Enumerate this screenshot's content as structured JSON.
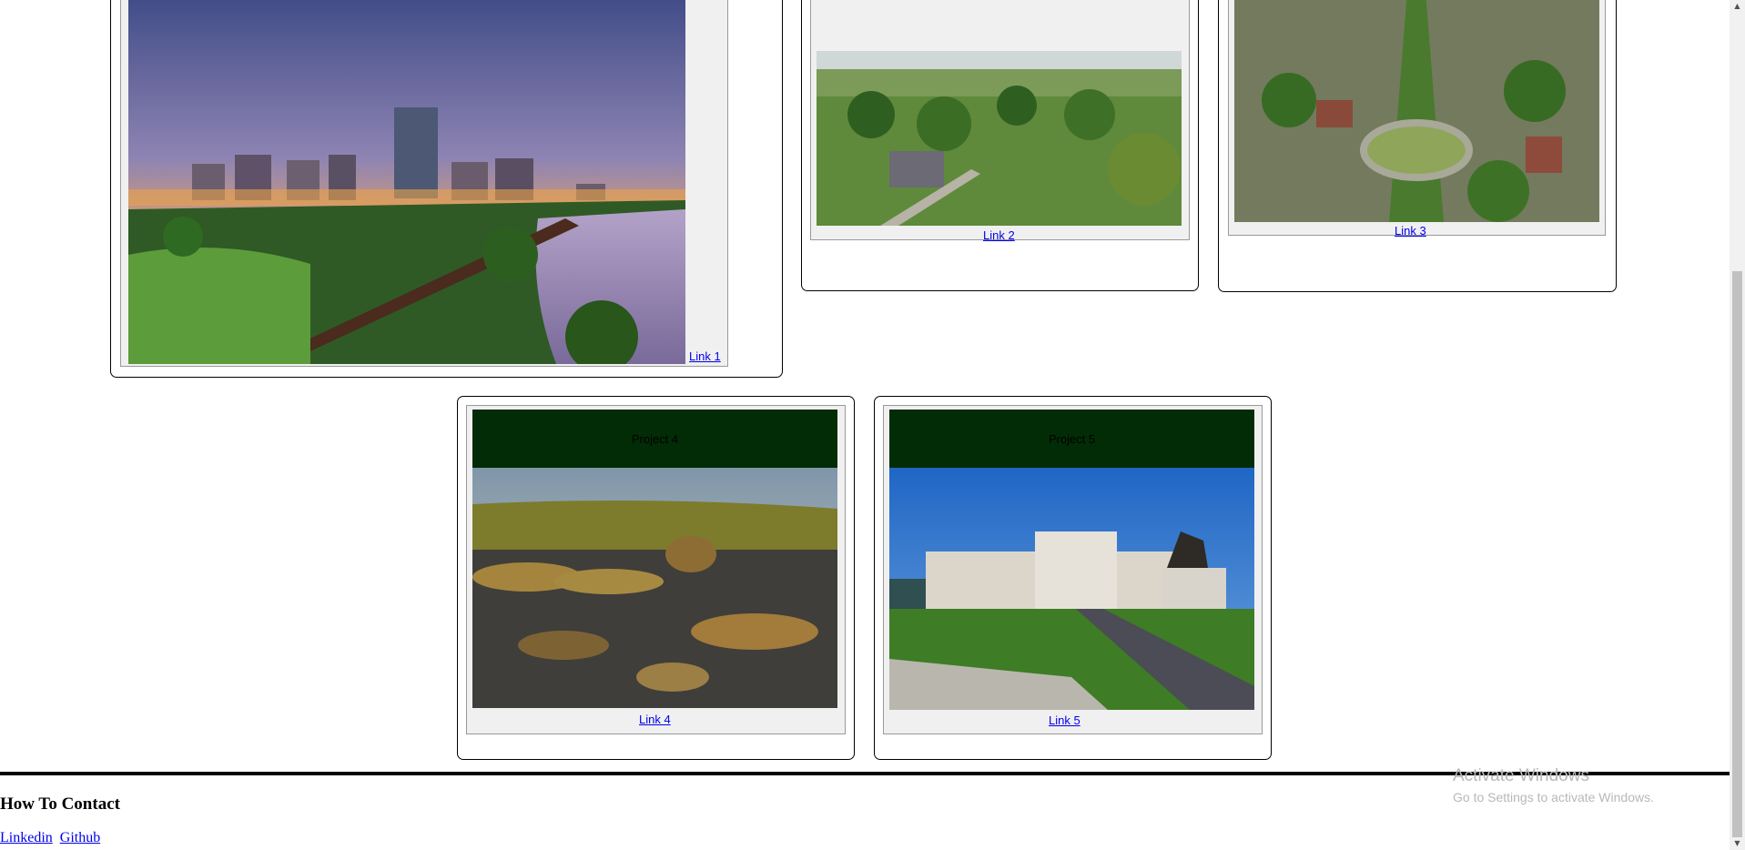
{
  "projects": [
    {
      "banner": "",
      "link": "Link 1"
    },
    {
      "banner": "",
      "link": "Link 2"
    },
    {
      "banner": "",
      "link": "Link 3"
    },
    {
      "banner": "Project 4",
      "link": "Link 4"
    },
    {
      "banner": "Project 5",
      "link": "Link 5"
    }
  ],
  "contact": {
    "heading": "How To Contact",
    "links": [
      "Linkedin",
      "Github"
    ]
  },
  "watermark": {
    "title": "Activate Windows",
    "subtitle": "Go to Settings to activate Windows."
  },
  "colors": {
    "banner": "#012c06",
    "link": "#0000ee",
    "card_inner": "#f0f0f0"
  },
  "icons": {
    "scroll_up": "scroll-up-arrow-icon",
    "scroll_down": "scroll-down-arrow-icon"
  }
}
